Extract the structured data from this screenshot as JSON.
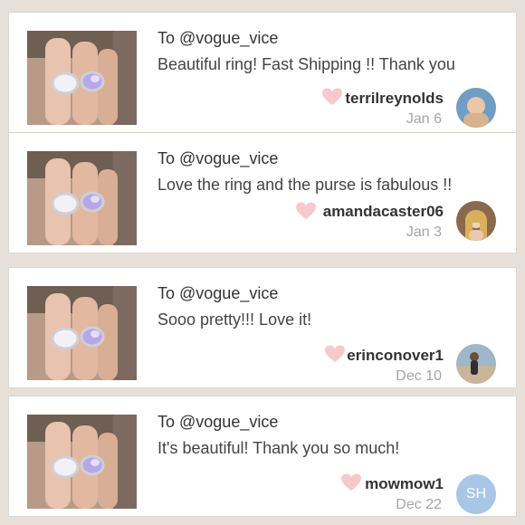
{
  "reviews": [
    {
      "to": "To @vogue_vice",
      "message": "Beautiful ring! Fast Shipping !! Thank you",
      "username": "terrilreynolds",
      "date": "Jan 6",
      "avatar_icon": "user-photo-icon",
      "heart_color": "#f7c8cf"
    },
    {
      "to": "To @vogue_vice",
      "message": "Love the ring and the purse is fabulous !!",
      "username": "amandacaster06",
      "date": "Jan 3",
      "avatar_icon": "user-photo-icon",
      "heart_color": "#f7c8cf"
    },
    {
      "to": "To @vogue_vice",
      "message": "Sooo pretty!!! Love it!",
      "username": "erinconover1",
      "date": "Dec 10",
      "avatar_icon": "user-photo-icon",
      "heart_color": "#f7c8cf"
    },
    {
      "to": "To @vogue_vice",
      "message": "It's beautiful! Thank you so much!",
      "username": "mowmow1",
      "date": "Dec 22",
      "avatar_initials": "SH",
      "avatar_color": "#a8c6e6",
      "heart_color": "#f7c8cf"
    }
  ]
}
